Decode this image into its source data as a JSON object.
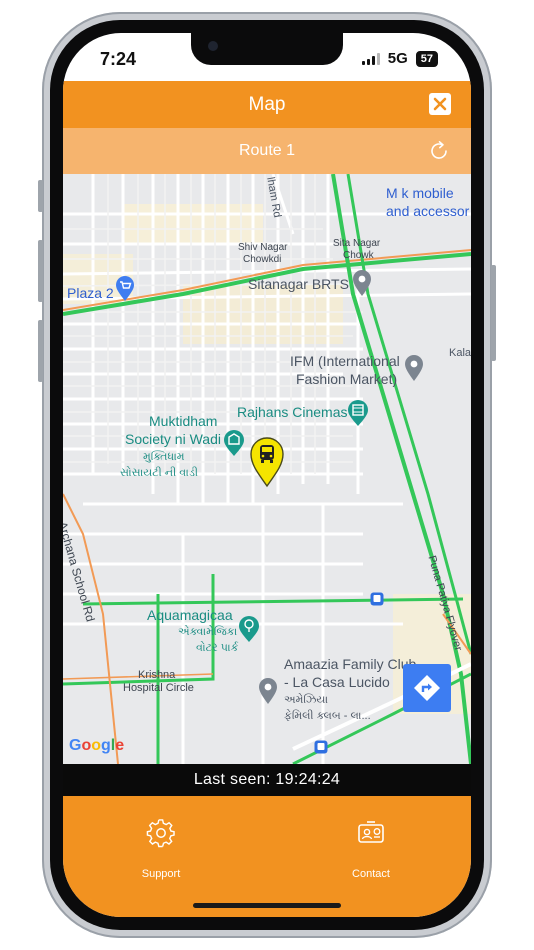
{
  "status_bar": {
    "time": "7:24",
    "network": "5G",
    "battery": "57"
  },
  "header": {
    "title": "Map"
  },
  "subheader": {
    "route": "Route 1"
  },
  "map": {
    "labels": {
      "m_k_mobile": "M k mobile",
      "and_accessories": "and accessor",
      "shiv_nagar": "Shiv Nagar",
      "chowkdi": "Chowkdi",
      "sita_nagar": "Sita Nagar",
      "chowk": "Chowk",
      "plaza2": "Plaza 2",
      "sitanagar_brts": "Sitanagar BRTS",
      "ifm_line1": "IFM (International",
      "ifm_line2": "Fashion Market)",
      "kala": "Kala",
      "rajhans": "Rajhans Cinemas",
      "muktidham1": "Muktidham",
      "muktidham2": "Society ni Wadi",
      "muktidham_guj1": "મુક્તિધામ",
      "muktidham_guj2": "સોસાયટી ની વાડી",
      "archana": "Archana School Rd",
      "puna_patiya": "Puna Patiya Flyover",
      "aquamagicaa": "Aquamagicaa",
      "aquamagicaa_guj1": "એક્વામેજિકા",
      "aquamagicaa_guj2": "વોટર પાર્ક",
      "krishna1": "Krishna",
      "krishna2": "Hospital Circle",
      "amaazia1": "Amaazia Family Club",
      "amaazia2": "- La Casa Lucido",
      "amaazia_guj1": "અમેઝિયા",
      "amaazia_guj2": "ફેમિલી ક્લબ - લા...",
      "road_top": "lham Rd",
      "google": "Google"
    }
  },
  "last_seen": "Last seen: 19:24:24",
  "tabs": [
    {
      "label": "Support",
      "icon": "gear-icon"
    },
    {
      "label": "Contact",
      "icon": "contact-card-icon"
    }
  ],
  "colors": {
    "accent": "#f29220",
    "accent_light": "#f6b46e",
    "bus_marker": "#f5e400"
  }
}
